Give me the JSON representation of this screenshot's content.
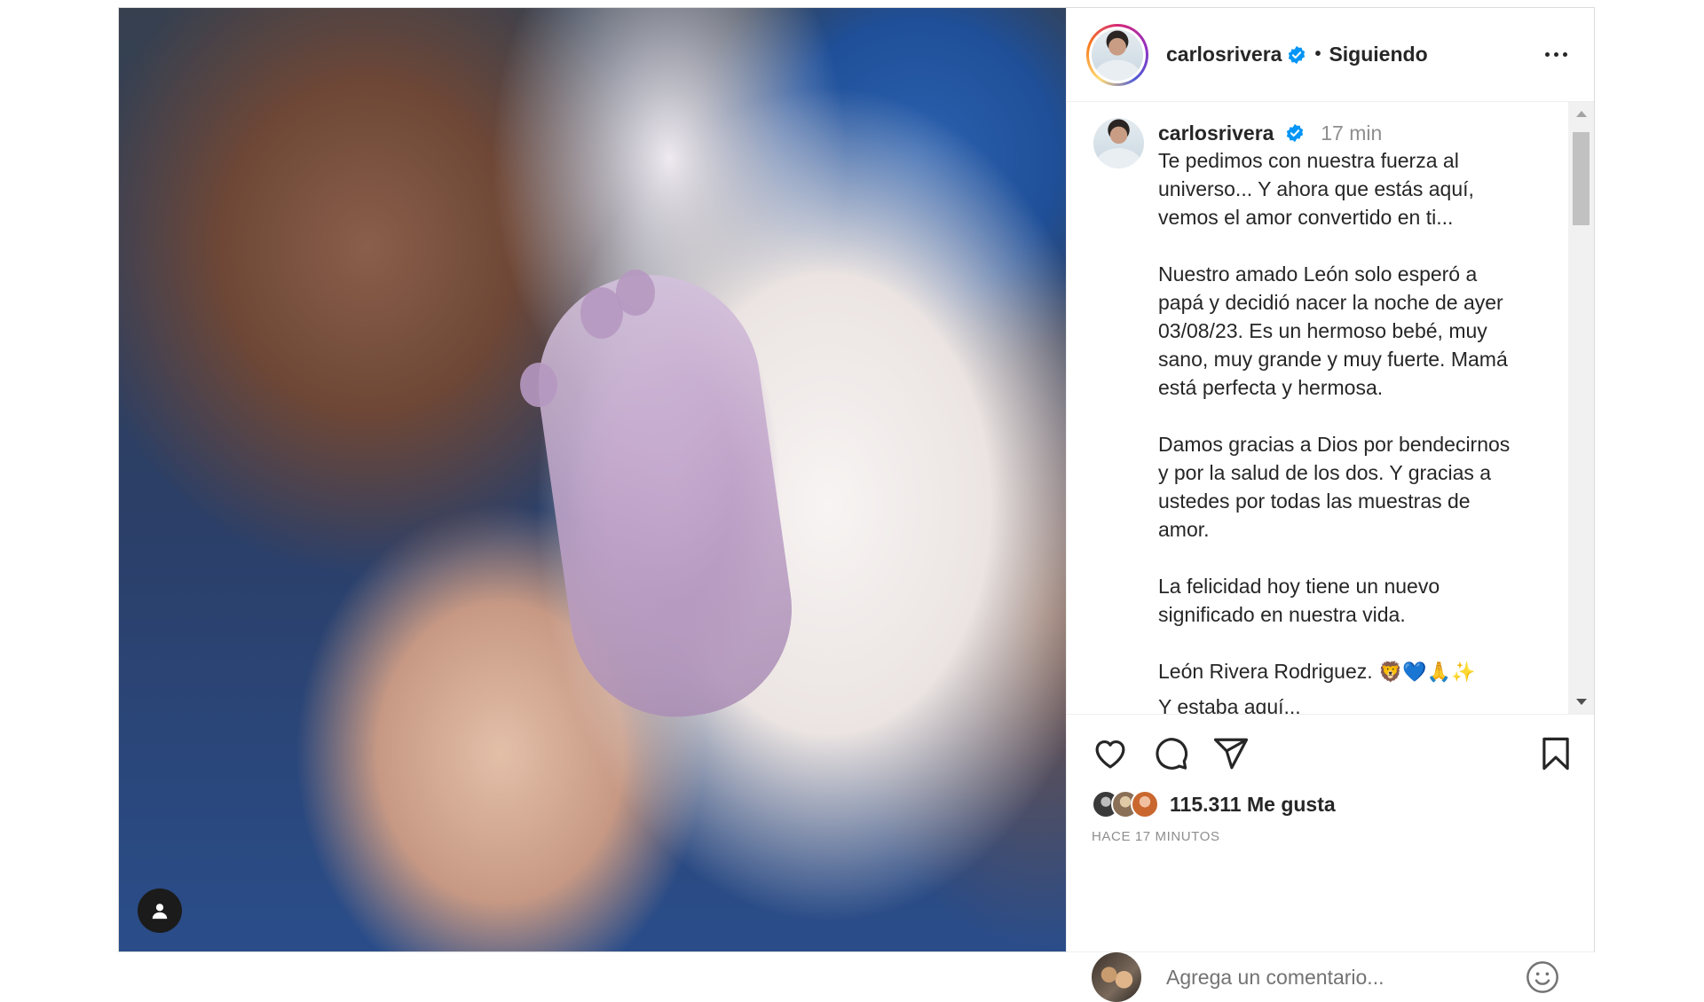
{
  "post": {
    "username": "carlosrivera",
    "follow_status": "Siguiendo",
    "separator": "•"
  },
  "caption": {
    "username": "carlosrivera",
    "time": "17 min",
    "paragraphs": [
      "Te pedimos con nuestra fuerza al\nuniverso... Y ahora que estás aquí,\nvemos el amor convertido en ti...",
      "Nuestro amado León solo esperó a\npapá y decidió nacer la noche de ayer\n03/08/23. Es un hermoso bebé, muy\nsano, muy grande y muy fuerte. Mamá\nestá perfecta y hermosa.",
      "Damos gracias a Dios por bendecirnos\ny por la salud de los dos. Y gracias a\nustedes por todas las muestras de\namor.",
      "La felicidad hoy tiene un nuevo\nsignificado en nuestra vida."
    ],
    "last_line_text": "León Rivera Rodriguez.",
    "last_line_emoji": "🦁💙🙏✨",
    "cut_off_line": "Y estaba aquí..."
  },
  "actions": {
    "likes": "115.311 Me gusta",
    "time_ago": "HACE 17 MINUTOS"
  },
  "comment_box": {
    "placeholder": "Agrega un comentario..."
  },
  "icons": {
    "more": "more-options-icon",
    "like": "heart-icon",
    "comment": "comment-bubble-icon",
    "share": "paper-plane-icon",
    "save": "bookmark-icon",
    "emoji": "smiley-icon",
    "tag": "user-tag-icon",
    "verified": "verified-badge-icon"
  },
  "colors": {
    "verified": "#0095f6",
    "text": "#262626",
    "secondary": "#8e8e8e"
  }
}
